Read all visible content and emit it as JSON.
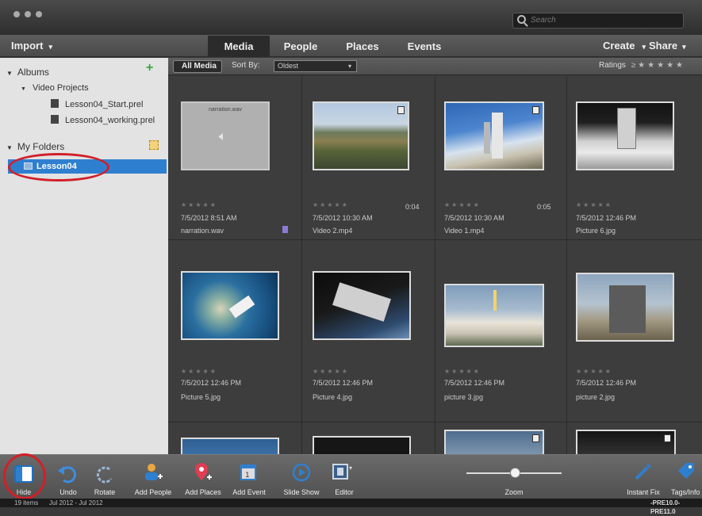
{
  "search": {
    "placeholder": "Search"
  },
  "menu": {
    "import_label": "Import",
    "tabs": [
      {
        "label": "Media",
        "active": true
      },
      {
        "label": "People"
      },
      {
        "label": "Places"
      },
      {
        "label": "Events"
      }
    ],
    "create_label": "Create",
    "share_label": "Share"
  },
  "sidebar": {
    "albums_label": "Albums",
    "video_projects_label": "Video Projects",
    "projects": [
      "Lesson04_Start.prel",
      "Lesson04_working.prel"
    ],
    "my_folders_label": "My Folders",
    "folder_label": "Lesson04"
  },
  "content_bar": {
    "all_media_label": "All Media",
    "sort_label": "Sort By:",
    "sort_value": "Oldest",
    "ratings_label": "Ratings"
  },
  "media": [
    {
      "date": "7/5/2012 8:51 AM",
      "name": "narration.wav",
      "duration": "",
      "thumb_caption": "narration.wav"
    },
    {
      "date": "7/5/2012 10:30 AM",
      "name": "Video 2.mp4",
      "duration": "0:04"
    },
    {
      "date": "7/5/2012 10:30 AM",
      "name": "Video 1.mp4",
      "duration": "0:05"
    },
    {
      "date": "7/5/2012 12:46 PM",
      "name": "Picture 6.jpg",
      "duration": ""
    },
    {
      "date": "7/5/2012 12:46 PM",
      "name": "Picture 5.jpg",
      "duration": ""
    },
    {
      "date": "7/5/2012 12:46 PM",
      "name": "Picture 4.jpg",
      "duration": ""
    },
    {
      "date": "7/5/2012 12:46 PM",
      "name": "picture 3.jpg",
      "duration": ""
    },
    {
      "date": "7/5/2012 12:46 PM",
      "name": "picture 2.jpg",
      "duration": ""
    }
  ],
  "toolbar": {
    "hide": "Hide",
    "undo": "Undo",
    "rotate": "Rotate",
    "add_people": "Add People",
    "add_places": "Add Places",
    "add_event": "Add Event",
    "slide_show": "Slide Show",
    "editor": "Editor",
    "zoom": "Zoom",
    "instant_fix": "Instant Fix",
    "tags_info": "Tags/Info"
  },
  "status": {
    "items": "19 items",
    "range": "Jul 2012 - Jul 2012",
    "version": "-PRE10.0-PRE11.0"
  },
  "colors": {
    "accent": "#2f7fd0",
    "annotation": "#d21f28"
  }
}
